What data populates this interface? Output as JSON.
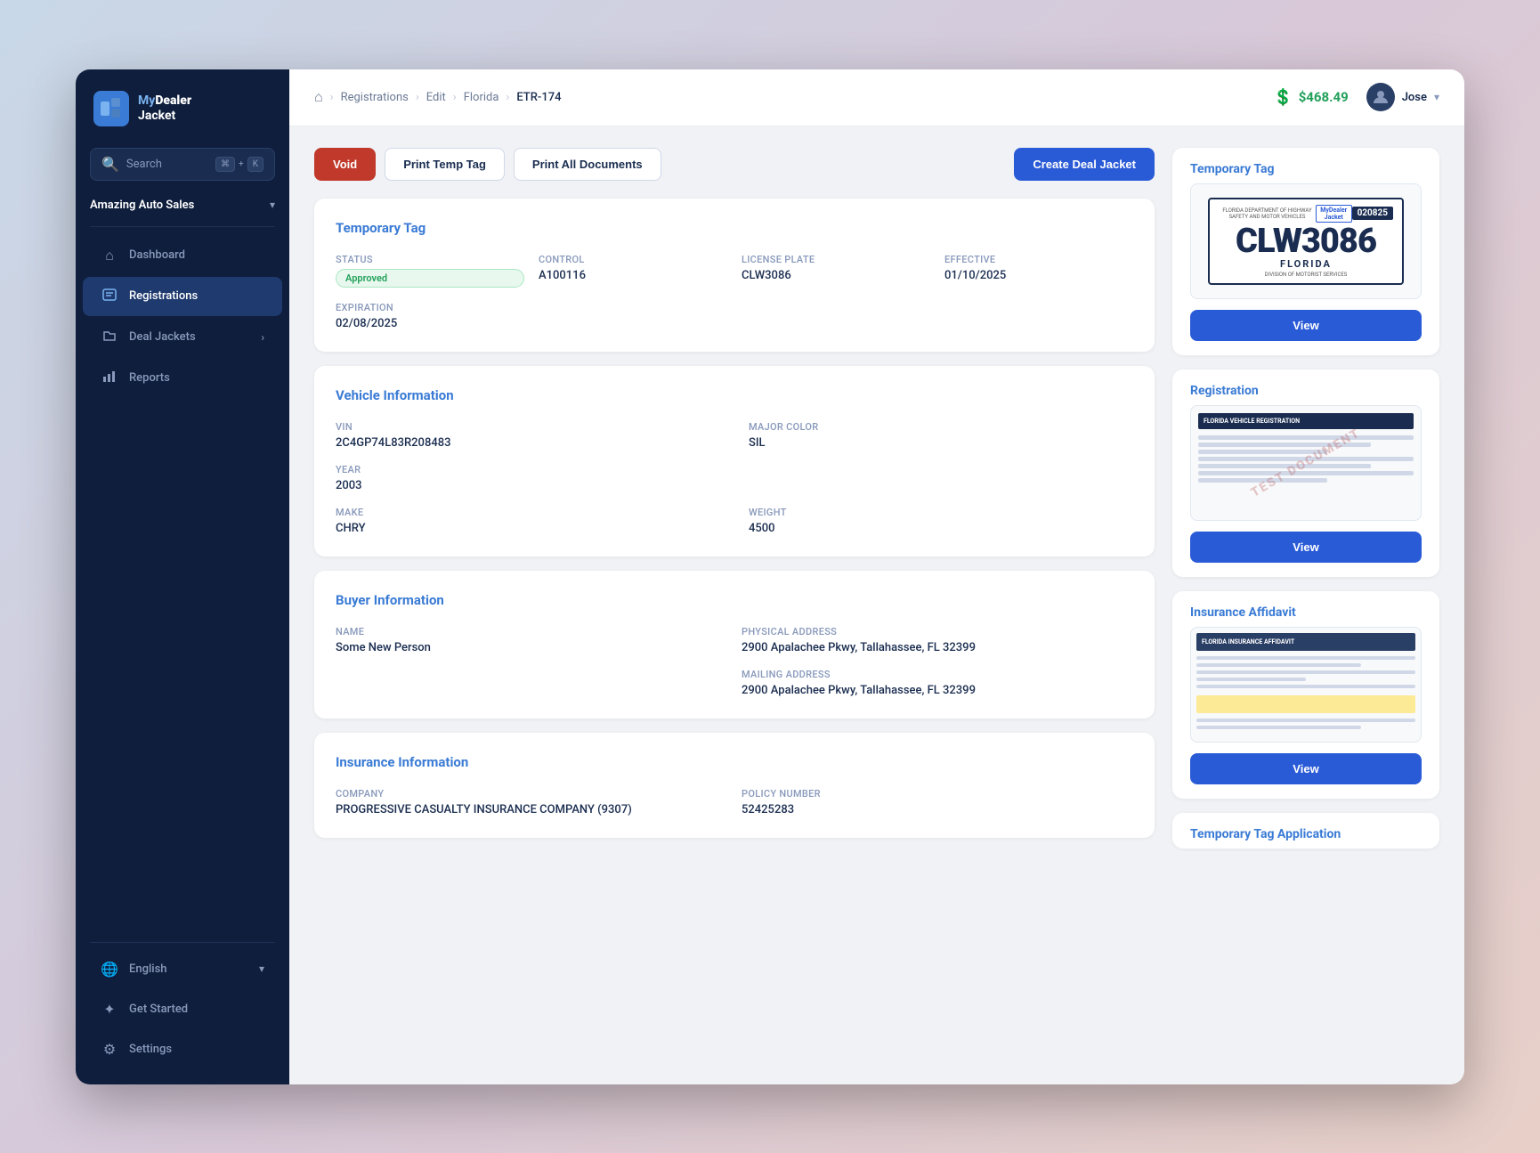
{
  "app": {
    "logo_line1": "My",
    "logo_line2": "Dealer",
    "logo_line3": "Jacket"
  },
  "search": {
    "placeholder": "Search",
    "kbd1": "⌘",
    "kbd2": "K"
  },
  "dealer": {
    "name": "Amazing Auto Sales"
  },
  "nav": {
    "items": [
      {
        "id": "dashboard",
        "label": "Dashboard",
        "icon": "⌂"
      },
      {
        "id": "registrations",
        "label": "Registrations",
        "icon": "▤",
        "active": true
      },
      {
        "id": "deal-jackets",
        "label": "Deal Jackets",
        "icon": "📁",
        "has_expand": true
      },
      {
        "id": "reports",
        "label": "Reports",
        "icon": "📊"
      }
    ]
  },
  "sidebar_bottom": {
    "language": {
      "label": "English",
      "icon": "🌐"
    },
    "get_started": {
      "label": "Get Started",
      "icon": "✦"
    },
    "settings": {
      "label": "Settings",
      "icon": "⚙"
    }
  },
  "topbar": {
    "breadcrumbs": [
      "Registrations",
      "Edit",
      "Florida",
      "ETR-174"
    ],
    "balance": "$468.49",
    "user": "Jose"
  },
  "actions": {
    "void": "Void",
    "print_temp": "Print Temp Tag",
    "print_all": "Print All Documents",
    "create_deal": "Create Deal Jacket"
  },
  "temp_tag": {
    "section_title": "Temporary Tag",
    "status_label": "Status",
    "status_value": "Approved",
    "control_label": "Control",
    "control_value": "A100116",
    "license_plate_label": "License Plate",
    "license_plate_value": "CLW3086",
    "effective_label": "Effective",
    "effective_value": "01/10/2025",
    "expiration_label": "Expiration",
    "expiration_value": "02/08/2025",
    "plate_display": "CLW3086",
    "state": "FLORIDA",
    "tag_number": "020825"
  },
  "vehicle": {
    "section_title": "Vehicle Information",
    "vin_label": "VIN",
    "vin_value": "2C4GP74L83R208483",
    "year_label": "Year",
    "year_value": "2003",
    "make_label": "Make",
    "make_value": "CHRY",
    "major_color_label": "Major Color",
    "major_color_value": "SIL",
    "weight_label": "Weight",
    "weight_value": "4500"
  },
  "buyer": {
    "section_title": "Buyer Information",
    "name_label": "Name",
    "name_value": "Some New Person",
    "physical_address_label": "Physical Address",
    "physical_address_value": "2900 Apalachee Pkwy, Tallahassee, FL 32399",
    "mailing_address_label": "Mailing Address",
    "mailing_address_value": "2900 Apalachee Pkwy, Tallahassee, FL 32399"
  },
  "insurance": {
    "section_title": "Insurance Information",
    "company_label": "Company",
    "company_value": "PROGRESSIVE CASUALTY INSURANCE COMPANY (9307)",
    "policy_number_label": "Policy Number",
    "policy_number_value": "52425283"
  },
  "right_panel": {
    "temp_tag_title": "Temporary Tag",
    "registration_title": "Registration",
    "insurance_affidavit_title": "Insurance Affidavit",
    "temp_tag_app_title": "Temporary Tag Application",
    "view_label": "View"
  }
}
